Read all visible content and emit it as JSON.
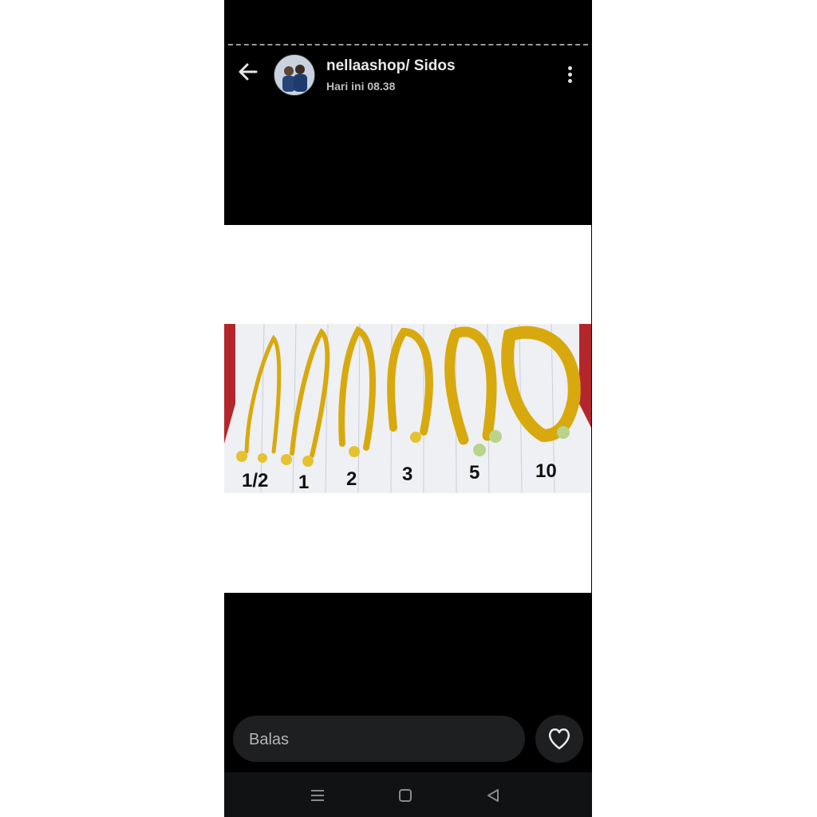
{
  "header": {
    "title": "nellaashop/ Sidos",
    "time": "Hari ini 08.38"
  },
  "story": {
    "labels": [
      "1/2",
      "1",
      "2",
      "3",
      "5",
      "10"
    ]
  },
  "reply": {
    "placeholder": "Balas"
  },
  "icons": {
    "back": "arrow-left-icon",
    "more": "more-vertical-icon",
    "like": "heart-icon",
    "nav_menu": "menu-icon",
    "nav_home": "home-square-icon",
    "nav_back": "back-triangle-icon"
  }
}
